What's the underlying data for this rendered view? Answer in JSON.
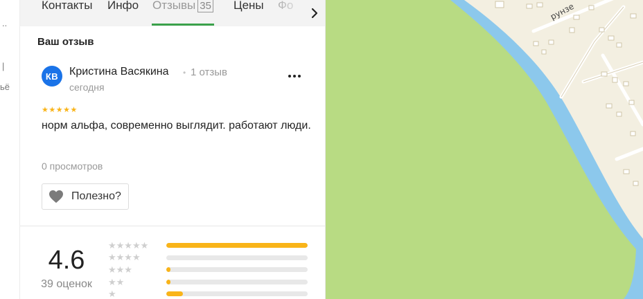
{
  "left_rail": {
    "mark_top": "..",
    "mark_mid": "|",
    "mark_bottom": "ьё"
  },
  "tabs": {
    "items": [
      {
        "label": "Контакты"
      },
      {
        "label": "Инфо"
      },
      {
        "label": "Отзывы",
        "count": "35",
        "active": true
      },
      {
        "label": "Цены"
      },
      {
        "label": "Фо"
      }
    ],
    "next_icon": "chevron-right-icon"
  },
  "review": {
    "section_title": "Ваш отзыв",
    "author": {
      "initials": "КВ",
      "name": "Кристина Васякина",
      "separator": "•",
      "reviews_count": "1 отзыв"
    },
    "date": "сегодня",
    "stars": "★★★★★",
    "rating": 5,
    "text": "норм альфа, современно выглядит. работают люди.",
    "views": "0 просмотров",
    "useful_label": "Полезно?",
    "more_icon": "more-dots-icon"
  },
  "summary": {
    "average": "4.6",
    "ratings_count": "39 оценок",
    "distribution": [
      {
        "stars": "★★★★★",
        "fraction": 1.0
      },
      {
        "stars": "★★★★",
        "fraction": 0.0
      },
      {
        "stars": "★★★",
        "fraction": 0.03
      },
      {
        "stars": "★★",
        "fraction": 0.03
      },
      {
        "stars": "★",
        "fraction": 0.12
      }
    ]
  },
  "map": {
    "street_label": "рунзе"
  },
  "colors": {
    "accent_green": "#3aa14a",
    "star": "#f9b419",
    "avatar": "#1a73e8",
    "park": "#b8db83",
    "river": "#8cc8ec"
  }
}
